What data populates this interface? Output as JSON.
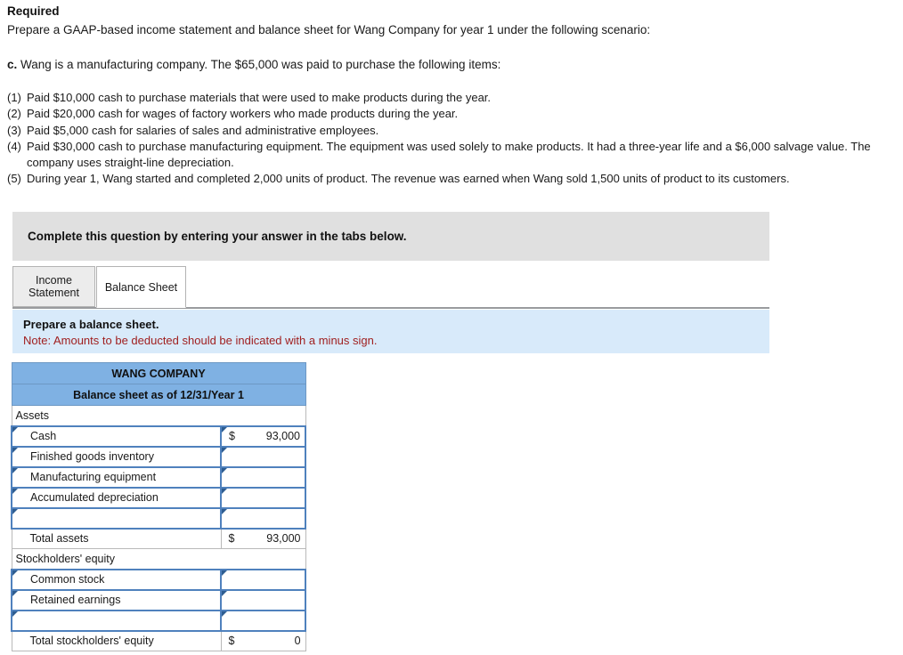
{
  "required": {
    "heading": "Required",
    "instruction": "Prepare a GAAP-based income statement and balance sheet for Wang Company for year 1 under the following scenario:",
    "scenario_label": "c.",
    "scenario_text": " Wang is a manufacturing company. The $65,000 was paid to purchase the following items:",
    "items": [
      {
        "num": "(1)",
        "text": "Paid $10,000 cash to purchase materials that were used to make products during the year."
      },
      {
        "num": "(2)",
        "text": "Paid $20,000 cash for wages of factory workers who made products during the year."
      },
      {
        "num": "(3)",
        "text": "Paid $5,000 cash for salaries of sales and administrative employees."
      },
      {
        "num": "(4)",
        "text": "Paid $30,000 cash to purchase manufacturing equipment. The equipment was used solely to make products. It had a three-year life and a $6,000 salvage value. The company uses straight-line depreciation."
      },
      {
        "num": "(5)",
        "text": "During year 1, Wang started and completed 2,000 units of product. The revenue was earned when Wang sold 1,500 units of product to its customers."
      }
    ]
  },
  "banner": {
    "text": "Complete this question by entering your answer in the tabs below."
  },
  "tabs": [
    {
      "label_line1": "Income",
      "label_line2": "Statement",
      "active": false
    },
    {
      "label_line1": "Balance Sheet",
      "label_line2": "",
      "active": true
    }
  ],
  "note": {
    "line1": "Prepare a balance sheet.",
    "line2": "Note: Amounts to be deducted should be indicated with a minus sign."
  },
  "balance_sheet": {
    "title": "WANG COMPANY",
    "subtitle": "Balance sheet as of 12/31/Year 1",
    "assets_header": "Assets",
    "equity_header": "Stockholders' equity",
    "currency_symbol": "$",
    "rows": {
      "cash_label": "Cash",
      "cash_value": "93,000",
      "finished_goods_label": "Finished goods inventory",
      "finished_goods_value": "",
      "manufacturing_equipment_label": "Manufacturing equipment",
      "manufacturing_equipment_value": "",
      "accumulated_depreciation_label": "Accumulated depreciation",
      "accumulated_depreciation_value": "",
      "asset_blank_label": "",
      "asset_blank_value": "",
      "total_assets_label": "Total assets",
      "total_assets_value": "93,000",
      "common_stock_label": "Common stock",
      "common_stock_value": "",
      "retained_earnings_label": "Retained earnings",
      "retained_earnings_value": "",
      "equity_blank_label": "",
      "equity_blank_value": "",
      "total_equity_label": "Total stockholders' equity",
      "total_equity_value": "0"
    }
  },
  "colors": {
    "header_blue": "#7fb1e3",
    "note_blue": "#d8eafa",
    "banner_gray": "#e0e0e0",
    "input_border": "#4f81bd",
    "warning_red": "#a02020"
  }
}
